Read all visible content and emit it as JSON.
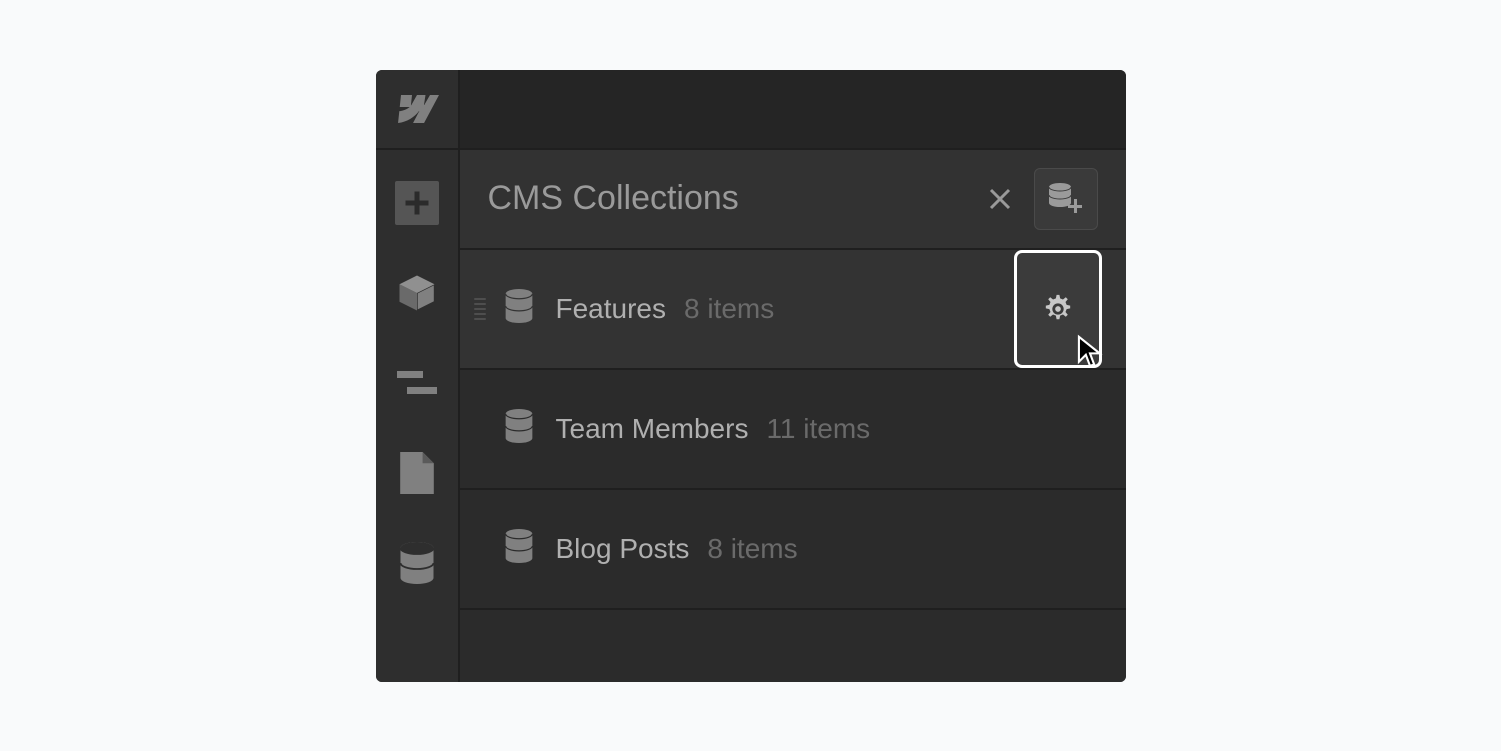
{
  "header": {
    "title": "CMS Collections"
  },
  "collections": [
    {
      "name": "Features",
      "count": "8 items",
      "hovered": true,
      "showSettings": true
    },
    {
      "name": "Team Members",
      "count": "11 items",
      "hovered": false,
      "showSettings": false
    },
    {
      "name": "Blog Posts",
      "count": "8 items",
      "hovered": false,
      "showSettings": false
    }
  ],
  "icons": {
    "logo": "webflow",
    "sidebar": [
      "add",
      "components",
      "navigator",
      "pages",
      "cms"
    ]
  }
}
